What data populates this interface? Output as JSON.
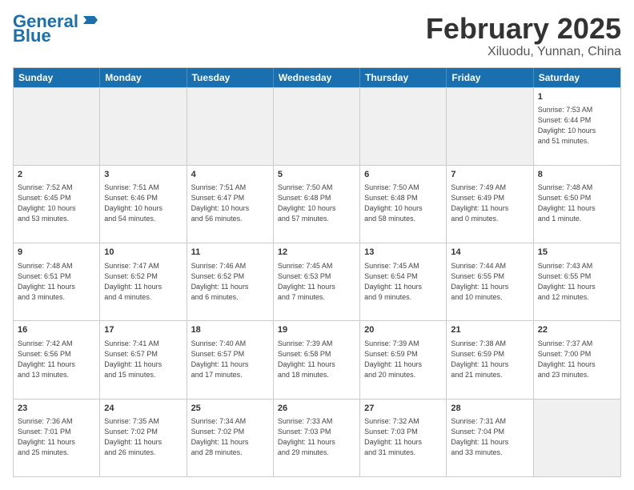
{
  "logo": {
    "line1": "General",
    "line2": "Blue"
  },
  "title": "February 2025",
  "location": "Xiluodu, Yunnan, China",
  "weekdays": [
    "Sunday",
    "Monday",
    "Tuesday",
    "Wednesday",
    "Thursday",
    "Friday",
    "Saturday"
  ],
  "rows": [
    [
      {
        "day": "",
        "info": ""
      },
      {
        "day": "",
        "info": ""
      },
      {
        "day": "",
        "info": ""
      },
      {
        "day": "",
        "info": ""
      },
      {
        "day": "",
        "info": ""
      },
      {
        "day": "",
        "info": ""
      },
      {
        "day": "1",
        "info": "Sunrise: 7:53 AM\nSunset: 6:44 PM\nDaylight: 10 hours\nand 51 minutes."
      }
    ],
    [
      {
        "day": "2",
        "info": "Sunrise: 7:52 AM\nSunset: 6:45 PM\nDaylight: 10 hours\nand 53 minutes."
      },
      {
        "day": "3",
        "info": "Sunrise: 7:51 AM\nSunset: 6:46 PM\nDaylight: 10 hours\nand 54 minutes."
      },
      {
        "day": "4",
        "info": "Sunrise: 7:51 AM\nSunset: 6:47 PM\nDaylight: 10 hours\nand 56 minutes."
      },
      {
        "day": "5",
        "info": "Sunrise: 7:50 AM\nSunset: 6:48 PM\nDaylight: 10 hours\nand 57 minutes."
      },
      {
        "day": "6",
        "info": "Sunrise: 7:50 AM\nSunset: 6:48 PM\nDaylight: 10 hours\nand 58 minutes."
      },
      {
        "day": "7",
        "info": "Sunrise: 7:49 AM\nSunset: 6:49 PM\nDaylight: 11 hours\nand 0 minutes."
      },
      {
        "day": "8",
        "info": "Sunrise: 7:48 AM\nSunset: 6:50 PM\nDaylight: 11 hours\nand 1 minute."
      }
    ],
    [
      {
        "day": "9",
        "info": "Sunrise: 7:48 AM\nSunset: 6:51 PM\nDaylight: 11 hours\nand 3 minutes."
      },
      {
        "day": "10",
        "info": "Sunrise: 7:47 AM\nSunset: 6:52 PM\nDaylight: 11 hours\nand 4 minutes."
      },
      {
        "day": "11",
        "info": "Sunrise: 7:46 AM\nSunset: 6:52 PM\nDaylight: 11 hours\nand 6 minutes."
      },
      {
        "day": "12",
        "info": "Sunrise: 7:45 AM\nSunset: 6:53 PM\nDaylight: 11 hours\nand 7 minutes."
      },
      {
        "day": "13",
        "info": "Sunrise: 7:45 AM\nSunset: 6:54 PM\nDaylight: 11 hours\nand 9 minutes."
      },
      {
        "day": "14",
        "info": "Sunrise: 7:44 AM\nSunset: 6:55 PM\nDaylight: 11 hours\nand 10 minutes."
      },
      {
        "day": "15",
        "info": "Sunrise: 7:43 AM\nSunset: 6:55 PM\nDaylight: 11 hours\nand 12 minutes."
      }
    ],
    [
      {
        "day": "16",
        "info": "Sunrise: 7:42 AM\nSunset: 6:56 PM\nDaylight: 11 hours\nand 13 minutes."
      },
      {
        "day": "17",
        "info": "Sunrise: 7:41 AM\nSunset: 6:57 PM\nDaylight: 11 hours\nand 15 minutes."
      },
      {
        "day": "18",
        "info": "Sunrise: 7:40 AM\nSunset: 6:57 PM\nDaylight: 11 hours\nand 17 minutes."
      },
      {
        "day": "19",
        "info": "Sunrise: 7:39 AM\nSunset: 6:58 PM\nDaylight: 11 hours\nand 18 minutes."
      },
      {
        "day": "20",
        "info": "Sunrise: 7:39 AM\nSunset: 6:59 PM\nDaylight: 11 hours\nand 20 minutes."
      },
      {
        "day": "21",
        "info": "Sunrise: 7:38 AM\nSunset: 6:59 PM\nDaylight: 11 hours\nand 21 minutes."
      },
      {
        "day": "22",
        "info": "Sunrise: 7:37 AM\nSunset: 7:00 PM\nDaylight: 11 hours\nand 23 minutes."
      }
    ],
    [
      {
        "day": "23",
        "info": "Sunrise: 7:36 AM\nSunset: 7:01 PM\nDaylight: 11 hours\nand 25 minutes."
      },
      {
        "day": "24",
        "info": "Sunrise: 7:35 AM\nSunset: 7:02 PM\nDaylight: 11 hours\nand 26 minutes."
      },
      {
        "day": "25",
        "info": "Sunrise: 7:34 AM\nSunset: 7:02 PM\nDaylight: 11 hours\nand 28 minutes."
      },
      {
        "day": "26",
        "info": "Sunrise: 7:33 AM\nSunset: 7:03 PM\nDaylight: 11 hours\nand 29 minutes."
      },
      {
        "day": "27",
        "info": "Sunrise: 7:32 AM\nSunset: 7:03 PM\nDaylight: 11 hours\nand 31 minutes."
      },
      {
        "day": "28",
        "info": "Sunrise: 7:31 AM\nSunset: 7:04 PM\nDaylight: 11 hours\nand 33 minutes."
      },
      {
        "day": "",
        "info": ""
      }
    ]
  ]
}
